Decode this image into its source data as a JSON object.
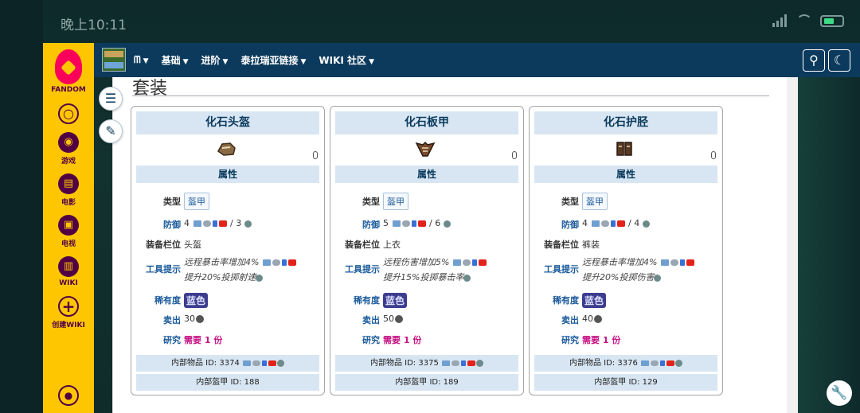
{
  "status": {
    "time": "晚上10:11"
  },
  "fandom": {
    "brand": "FANDOM",
    "items": [
      {
        "label": "游戏",
        "icon": "gamepad-icon"
      },
      {
        "label": "电影",
        "icon": "film-icon"
      },
      {
        "label": "电视",
        "icon": "tv-icon"
      },
      {
        "label": "WIKI",
        "icon": "book-icon"
      },
      {
        "label": "创建WIKI",
        "icon": "plus-icon"
      }
    ]
  },
  "nav": {
    "items": [
      {
        "label": "ᗰ",
        "has_menu": true
      },
      {
        "label": "基础",
        "has_menu": true
      },
      {
        "label": "进阶",
        "has_menu": true
      },
      {
        "label": "泰拉瑞亚链接",
        "has_menu": true
      },
      {
        "label": "WIKI 社区",
        "has_menu": true
      }
    ]
  },
  "section": {
    "title": "套装"
  },
  "labels": {
    "attributes": "属性",
    "type": "类型",
    "defense": "防御",
    "slot": "装备栏位",
    "tooltip": "工具提示",
    "rarity": "稀有度",
    "sell": "卖出",
    "research": "研究"
  },
  "cards": [
    {
      "name": "化石头盔",
      "type": "盔甲",
      "defense": "4",
      "defense_alt": "/ 3",
      "slot": "头盔",
      "tooltip_line1": "远程暴击率增加4%",
      "tooltip_line2": "提升20%投掷射速",
      "rarity": "蓝色",
      "sell": "30",
      "research": "需要 1 份",
      "item_id": "内部物品 ID: 3374",
      "armor_id": "内部盔甲 ID: 188"
    },
    {
      "name": "化石板甲",
      "type": "盔甲",
      "defense": "5",
      "defense_alt": "/ 6",
      "slot": "上衣",
      "tooltip_line1": "远程伤害增加5%",
      "tooltip_line2": "提升15%投掷暴击率",
      "rarity": "蓝色",
      "sell": "50",
      "research": "需要 1 份",
      "item_id": "内部物品 ID: 3375",
      "armor_id": "内部盔甲 ID: 189"
    },
    {
      "name": "化石护胫",
      "type": "盔甲",
      "defense": "4",
      "defense_alt": "/ 4",
      "slot": "裤装",
      "tooltip_line1": "远程暴击率增加4%",
      "tooltip_line2": "提升20%投掷伤害",
      "rarity": "蓝色",
      "sell": "40",
      "research": "需要 1 份",
      "item_id": "内部物品 ID: 3376",
      "armor_id": "内部盔甲 ID: 129"
    }
  ]
}
